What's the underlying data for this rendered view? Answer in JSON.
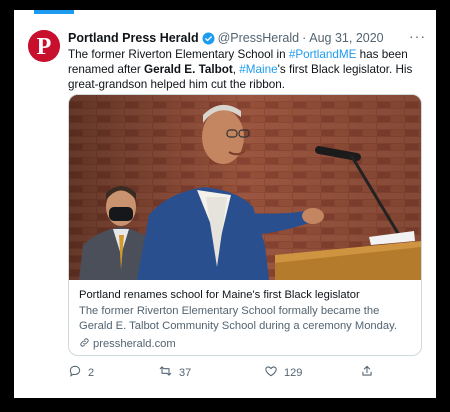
{
  "tweet": {
    "author_name": "Portland Press Herald",
    "handle": "@PressHerald",
    "separator": "·",
    "date": "Aug 31, 2020",
    "more_label": "···",
    "text": {
      "t1": "The former Riverton Elementary School in ",
      "hashtag1": "#PortlandME",
      "t2": " has been renamed after ",
      "name": "Gerald E. Talbot",
      "t3": ", ",
      "hashtag2": "#Maine",
      "t4": "'s first Black legislator. His great-grandson helped him cut the ribbon."
    }
  },
  "card": {
    "title": "Portland renames school for Maine's first Black legislator",
    "description": "The former Riverton Elementary School formally became the Gerald E. Talbot Community School during a ceremony Monday.",
    "domain": "pressherald.com"
  },
  "actions": {
    "replies": "2",
    "retweets": "37",
    "likes": "129"
  },
  "colors": {
    "accent": "#1d9bf0",
    "brand": "#c8102e",
    "muted": "#536471"
  },
  "icons": [
    "logo-p-icon",
    "verified-icon",
    "more-icon",
    "link-icon",
    "reply-icon",
    "retweet-icon",
    "like-icon",
    "share-icon"
  ]
}
